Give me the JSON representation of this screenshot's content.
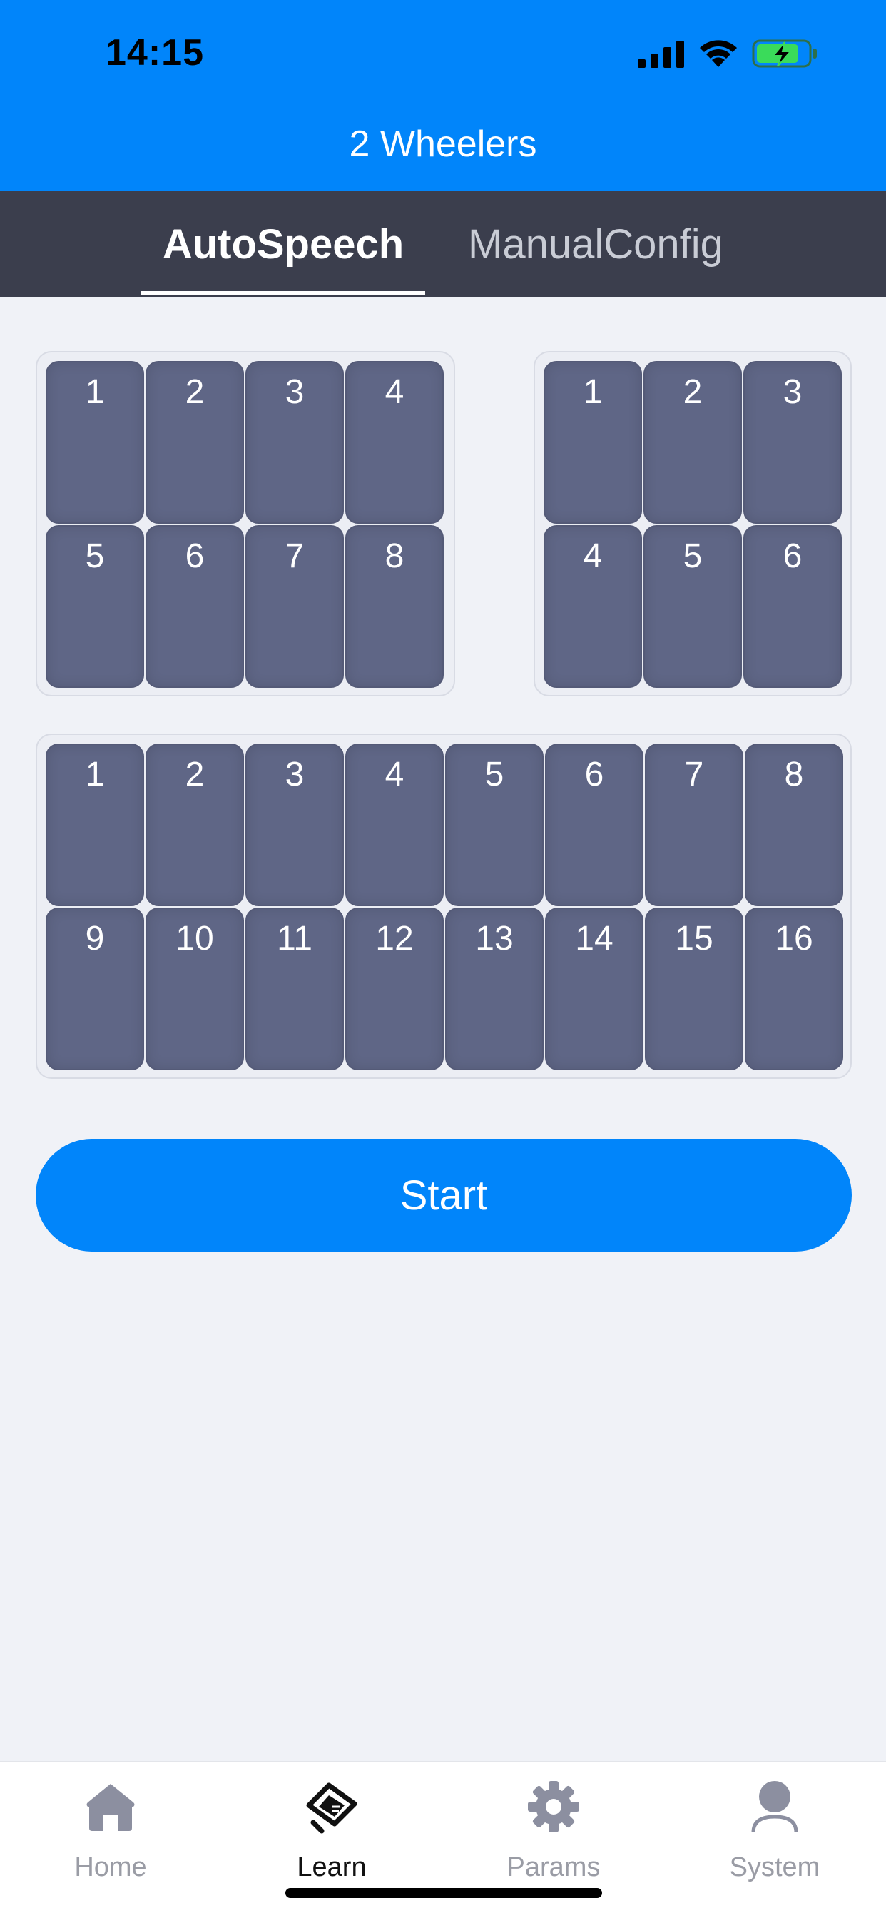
{
  "status": {
    "time": "14:15"
  },
  "header": {
    "title": "2 Wheelers"
  },
  "tabs": [
    {
      "label": "AutoSpeech",
      "active": true
    },
    {
      "label": "ManualConfig",
      "active": false
    }
  ],
  "panels": {
    "panel_a": {
      "cols": 4,
      "seats": [
        "1",
        "2",
        "3",
        "4",
        "5",
        "6",
        "7",
        "8"
      ]
    },
    "panel_b": {
      "cols": 3,
      "seats": [
        "1",
        "2",
        "3",
        "4",
        "5",
        "6"
      ]
    },
    "panel_c": {
      "cols": 8,
      "seats": [
        "1",
        "2",
        "3",
        "4",
        "5",
        "6",
        "7",
        "8",
        "9",
        "10",
        "11",
        "12",
        "13",
        "14",
        "15",
        "16"
      ]
    }
  },
  "start_button": {
    "label": "Start"
  },
  "nav": [
    {
      "label": "Home",
      "icon": "home-icon",
      "active": false
    },
    {
      "label": "Learn",
      "icon": "learn-icon",
      "active": true
    },
    {
      "label": "Params",
      "icon": "gear-icon",
      "active": false
    },
    {
      "label": "System",
      "icon": "person-icon",
      "active": false
    }
  ],
  "colors": {
    "accent": "#0185fa",
    "tab_bar": "#3b3e4d",
    "seat": "#5f6686",
    "background": "#f0f2f7"
  }
}
